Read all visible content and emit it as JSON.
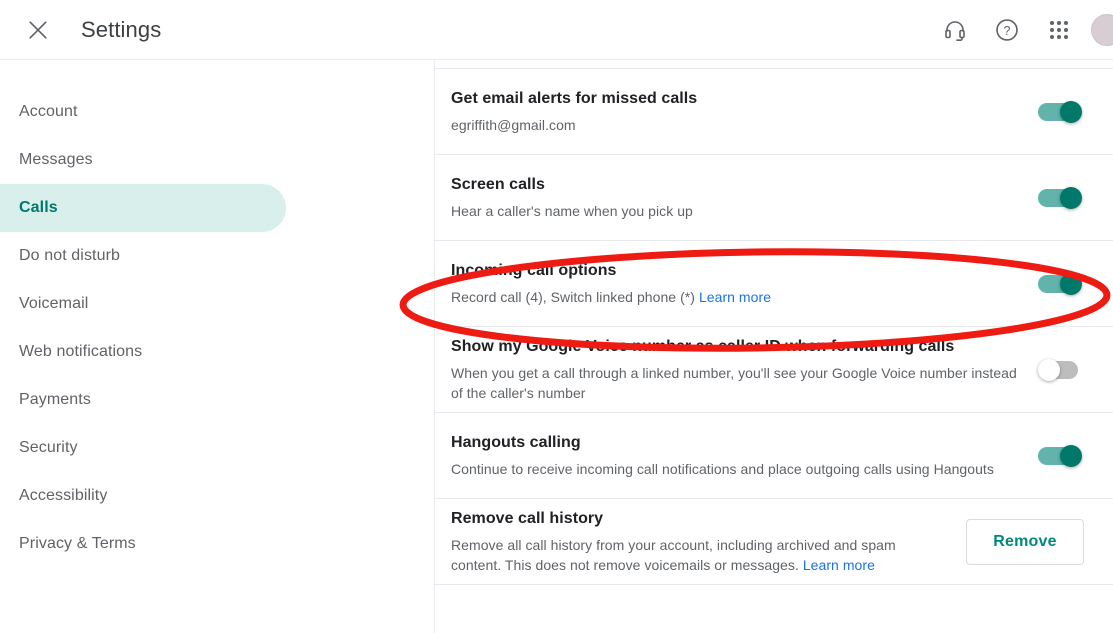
{
  "header": {
    "close_icon": "close-icon",
    "title": "Settings",
    "actions": [
      {
        "name": "support-headset-icon",
        "label": "Support"
      },
      {
        "name": "help-icon",
        "label": "Help"
      },
      {
        "name": "google-apps-icon",
        "label": "Google apps"
      },
      {
        "name": "avatar",
        "label": "Account"
      }
    ]
  },
  "sidebar": {
    "items": [
      {
        "label": "Account",
        "active": false
      },
      {
        "label": "Messages",
        "active": false
      },
      {
        "label": "Calls",
        "active": true
      },
      {
        "label": "Do not disturb",
        "active": false
      },
      {
        "label": "Voicemail",
        "active": false
      },
      {
        "label": "Web notifications",
        "active": false
      },
      {
        "label": "Payments",
        "active": false
      },
      {
        "label": "Security",
        "active": false
      },
      {
        "label": "Accessibility",
        "active": false
      },
      {
        "label": "Privacy & Terms",
        "active": false
      }
    ]
  },
  "settings": {
    "rows": [
      {
        "name": "email-alerts",
        "title": "Get email alerts for missed calls",
        "desc": "egriffith@gmail.com",
        "control": "toggle",
        "toggle_on": true
      },
      {
        "name": "screen-calls",
        "title": "Screen calls",
        "desc": "Hear a caller's name when you pick up",
        "control": "toggle",
        "toggle_on": true
      },
      {
        "name": "incoming-call-options",
        "title": "Incoming call options",
        "desc": "Record call (4), Switch linked phone (*) ",
        "link": "Learn more",
        "control": "toggle",
        "toggle_on": true
      },
      {
        "name": "caller-id-forwarding",
        "title": "Show my Google Voice number as caller ID when forwarding calls",
        "desc": "When you get a call through a linked number, you'll see your Google Voice number instead of the caller's number",
        "control": "toggle",
        "toggle_on": false
      },
      {
        "name": "hangouts-calling",
        "title": "Hangouts calling",
        "desc": "Continue to receive incoming call notifications and place outgoing calls using Hangouts",
        "control": "toggle",
        "toggle_on": true
      },
      {
        "name": "remove-call-history",
        "title": "Remove call history",
        "desc": "Remove all call history from your account, including archived and spam content. This does not remove voicemails or messages. ",
        "link": "Learn more",
        "control": "button",
        "button_label": "Remove"
      }
    ]
  },
  "annotation": {
    "shape": "ellipse",
    "color": "#ee1b13",
    "target": "Incoming call options"
  },
  "colors": {
    "accent_teal": "#00796b",
    "toggle_on_track": "#61b3ab",
    "toggle_off_track": "#bdbdbd",
    "link_blue": "#1a73e8",
    "active_nav_bg": "#d8efec",
    "annotation_red": "#ee1b13"
  }
}
